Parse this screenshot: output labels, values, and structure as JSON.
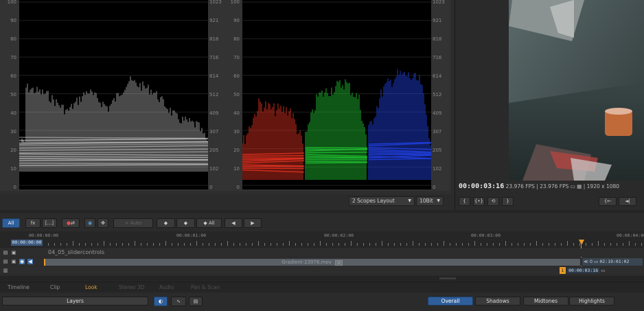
{
  "scopes": {
    "luma_left_ticks": [
      "100",
      "90",
      "80",
      "70",
      "60",
      "50",
      "40",
      "30",
      "20",
      "10",
      "0"
    ],
    "luma_right_ticks": [
      "1023",
      "921",
      "818",
      "716",
      "614",
      "512",
      "409",
      "307",
      "205",
      "102",
      "0"
    ],
    "rgb_left_ticks": [
      "100",
      "90",
      "80",
      "70",
      "60",
      "50",
      "40",
      "30",
      "20",
      "10",
      "0"
    ],
    "rgb_right_ticks": [
      "1023",
      "921",
      "818",
      "716",
      "614",
      "512",
      "409",
      "307",
      "205",
      "102",
      "0"
    ],
    "layout_select": "2 Scopes Layout",
    "bitdepth_select": "10Bit",
    "colors": {
      "red": "#e03020",
      "green": "#20c030",
      "blue": "#2040e0"
    }
  },
  "viewer": {
    "timecode": "00:00:03:16",
    "fps1": "23.976 FPS",
    "fps2": "23.976 FPS",
    "resolution": "1920 x 1080",
    "btn_mark_in": "{",
    "btn_mark_both": "{•}",
    "btn_loop": "⟲",
    "btn_mark_out": "}",
    "btn_go_in": "{←",
    "btn_prev": "◄|"
  },
  "toolbar": {
    "all": "All",
    "fx": "fx",
    "bracket": "[...]",
    "auto": "+ Auto",
    "key_all": "◆ All"
  },
  "ruler": {
    "current": "00:00:00:00",
    "labels": [
      "00:00:00:00",
      "00:00:01:00",
      "00:00:02:00",
      "00:00:03:00",
      "00:00:04:00"
    ]
  },
  "tracks": {
    "name": "04_05_slidercontrols",
    "clip_name": "Gradient-23976.mov",
    "clip_end": "02:19:01:02",
    "playhead_tc": "00:00:03:16",
    "counter": "0"
  },
  "tabs": [
    {
      "label": "Timeline",
      "state": "normal"
    },
    {
      "label": "Clip",
      "state": "normal"
    },
    {
      "label": "Look",
      "state": "active"
    },
    {
      "label": "Stereo 3D",
      "state": "dim"
    },
    {
      "label": "Audio",
      "state": "dim"
    },
    {
      "label": "Pan & Scan",
      "state": "dim"
    }
  ],
  "bottom": {
    "layers": "Layers",
    "ranges": [
      "Overall",
      "Shadows",
      "Midtones",
      "Highlights"
    ]
  }
}
